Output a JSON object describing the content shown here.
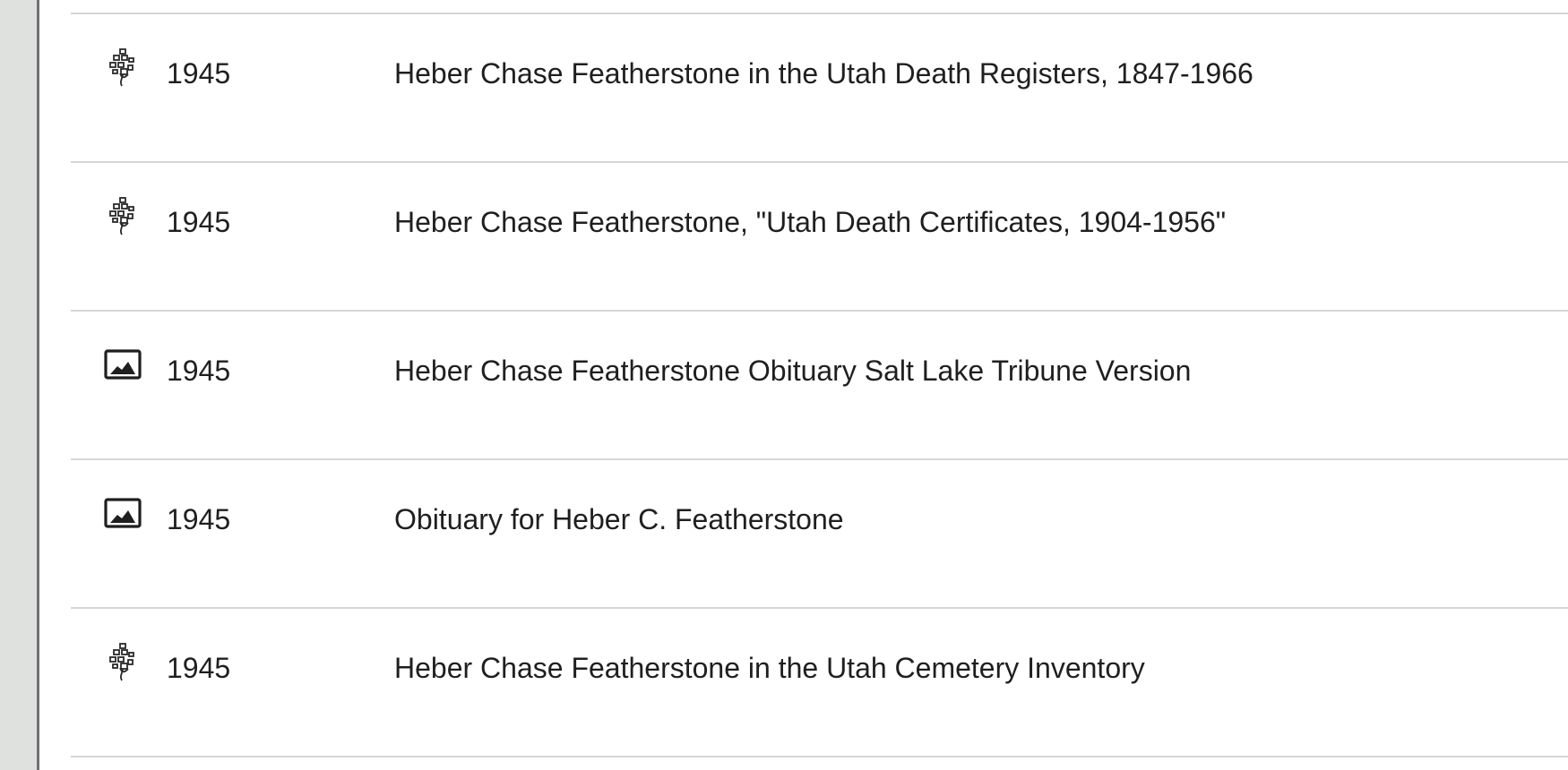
{
  "sources": [
    {
      "icon": "family-tree-icon",
      "year": "1945",
      "title": "Heber Chase Featherstone in the Utah Death Registers, 1847-1966"
    },
    {
      "icon": "family-tree-icon",
      "year": "1945",
      "title": "Heber Chase Featherstone, \"Utah Death Certificates, 1904-1956\""
    },
    {
      "icon": "image-icon",
      "year": "1945",
      "title": "Heber Chase Featherstone Obituary Salt Lake Tribune Version"
    },
    {
      "icon": "image-icon",
      "year": "1945",
      "title": "Obituary for Heber C. Featherstone"
    },
    {
      "icon": "family-tree-icon",
      "year": "1945",
      "title": "Heber Chase Featherstone in the Utah Cemetery Inventory"
    }
  ]
}
